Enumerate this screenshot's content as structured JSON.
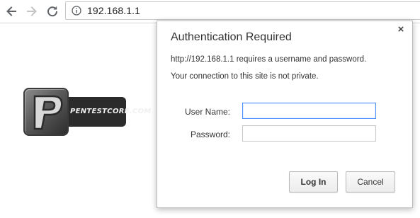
{
  "browser": {
    "address": "192.168.1.1"
  },
  "logo": {
    "text": "PENTESTCORE.COM",
    "letter": "P"
  },
  "dialog": {
    "title": "Authentication Required",
    "message": "http://192.168.1.1 requires a username and password.",
    "warning": "Your connection to this site is not private.",
    "username_label": "User Name:",
    "username_value": "",
    "password_label": "Password:",
    "password_value": "",
    "login_label": "Log In",
    "cancel_label": "Cancel",
    "close_glyph": "×"
  },
  "colors": {
    "focus_ring": "#4d90fe",
    "dialog_border": "#bcbcbc"
  },
  "icons": [
    "back-arrow-icon",
    "forward-arrow-icon",
    "reload-icon",
    "info-icon",
    "close-icon"
  ]
}
